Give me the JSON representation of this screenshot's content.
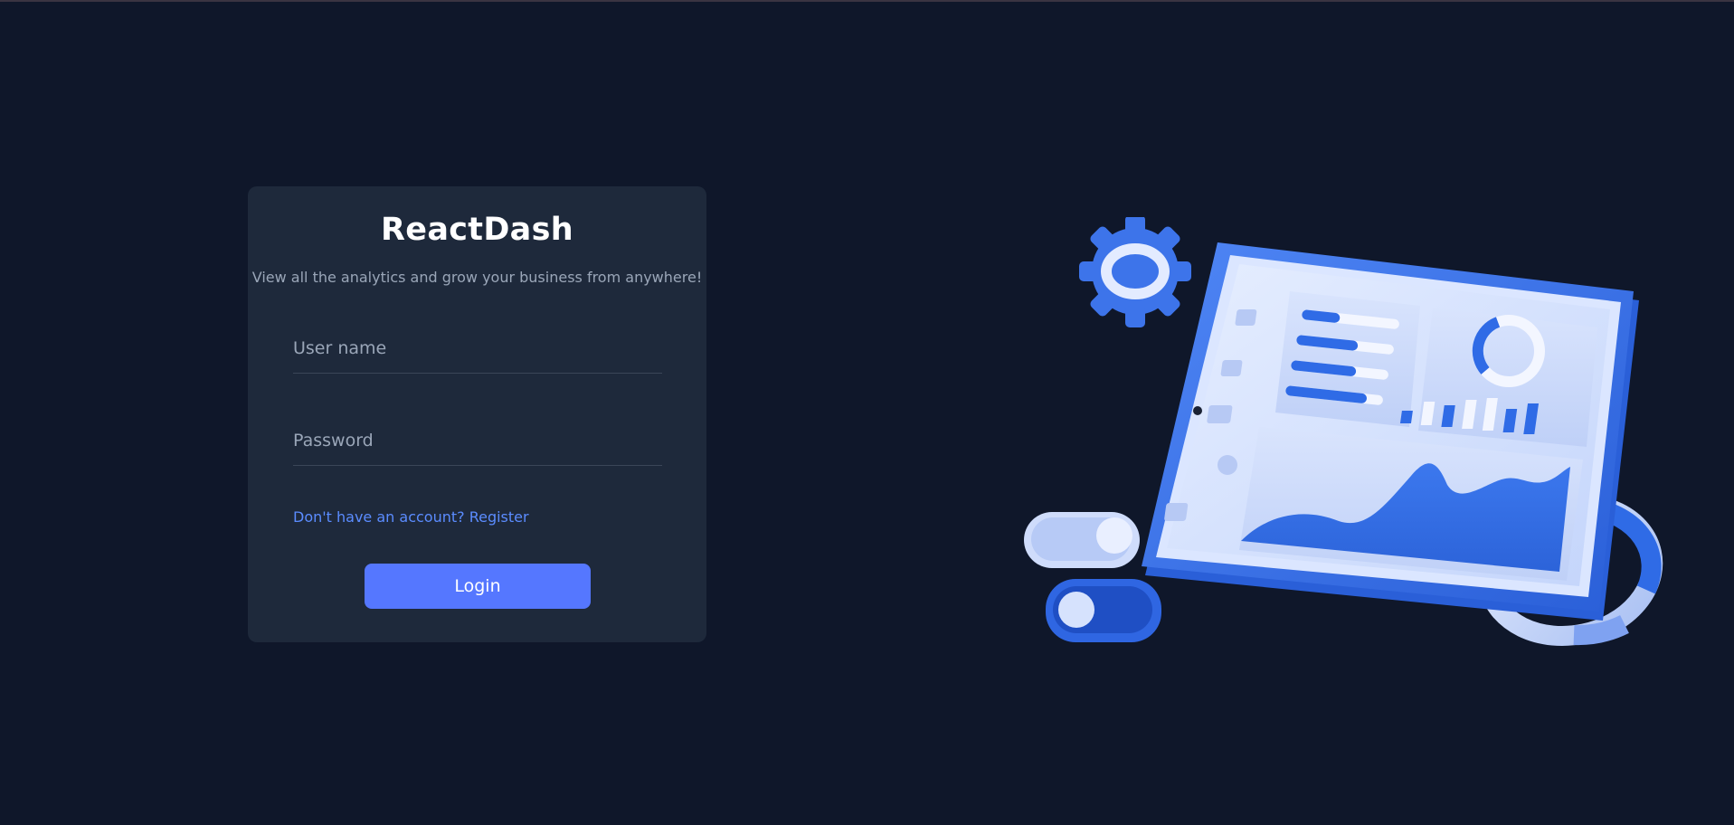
{
  "login_card": {
    "brand": "ReactDash",
    "tagline": "View all the analytics and grow your business from anywhere!",
    "username": {
      "placeholder": "User name",
      "value": ""
    },
    "password": {
      "placeholder": "Password",
      "value": ""
    },
    "register_link": "Don't have an account? Register",
    "login_button": "Login"
  },
  "colors": {
    "background": "#0f172a",
    "card": "#1e293b",
    "accent": "#5577ff",
    "link": "#5b8cff",
    "muted_text": "#9aa6b8"
  },
  "illustration": {
    "icons": [
      "gear-icon",
      "dashboard-tablet-illustration",
      "toggle-icon",
      "ring-chart-icon"
    ]
  }
}
